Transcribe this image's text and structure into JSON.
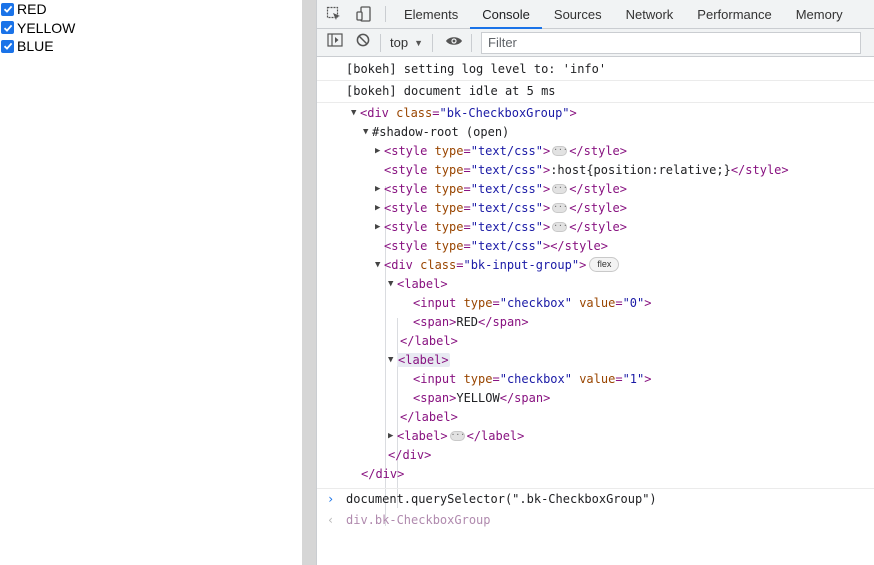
{
  "page": {
    "checkboxes": [
      {
        "label": "RED",
        "checked": true
      },
      {
        "label": "YELLOW",
        "checked": true
      },
      {
        "label": "BLUE",
        "checked": true
      }
    ]
  },
  "devtools": {
    "tabs": [
      "Elements",
      "Console",
      "Sources",
      "Network",
      "Performance",
      "Memory"
    ],
    "active_tab": "Console",
    "context": "top",
    "filter_placeholder": "Filter",
    "accent_color": "#1a73e8"
  },
  "console": {
    "messages": [
      "[bokeh] setting log level to: 'info'",
      "[bokeh] document idle at 5 ms"
    ],
    "tree": {
      "root_open": "<div class=\"bk-CheckboxGroup\">",
      "shadow_root": "#shadow-root (open)",
      "style_text_host": ":host{position:relative;}",
      "flex_badge": "flex",
      "input_red": "<input type=\"checkbox\" value=\"0\">",
      "span_red_text": "RED",
      "input_yellow": "<input type=\"checkbox\" value=\"1\">",
      "span_yellow_text": "YELLOW"
    },
    "input_command": "document.querySelector(\".bk-CheckboxGroup\")",
    "result": "div.bk-CheckboxGroup"
  }
}
